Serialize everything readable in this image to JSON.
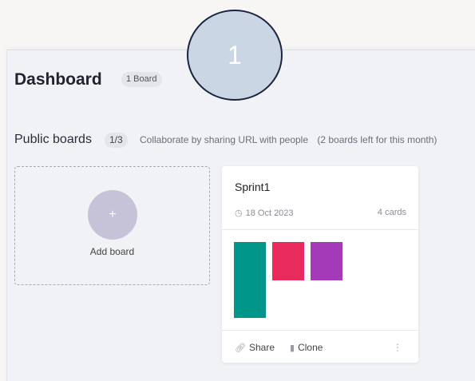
{
  "header": {
    "title": "Dashboard",
    "board_count": "1 Board"
  },
  "step_marker": "1",
  "public_boards": {
    "label": "Public boards",
    "count": "1/3",
    "description": "Collaborate by sharing URL with people",
    "remaining": "(2 boards left for this month)"
  },
  "add_board": {
    "plus": "+",
    "label": "Add board"
  },
  "board": {
    "name": "Sprint1",
    "date": "18 Oct 2023",
    "cards": "4 cards",
    "preview": [
      {
        "color": "#009689",
        "height": 95
      },
      {
        "color": "#e82a5c",
        "height": 48
      },
      {
        "color": "#a43ab7",
        "height": 48
      }
    ],
    "actions": {
      "share": "Share",
      "clone": "Clone",
      "more": "⋮"
    }
  },
  "icons": {
    "clock": "clock-icon",
    "share": "link-icon",
    "clone": "copy-icon",
    "more": "more-vertical-icon"
  }
}
